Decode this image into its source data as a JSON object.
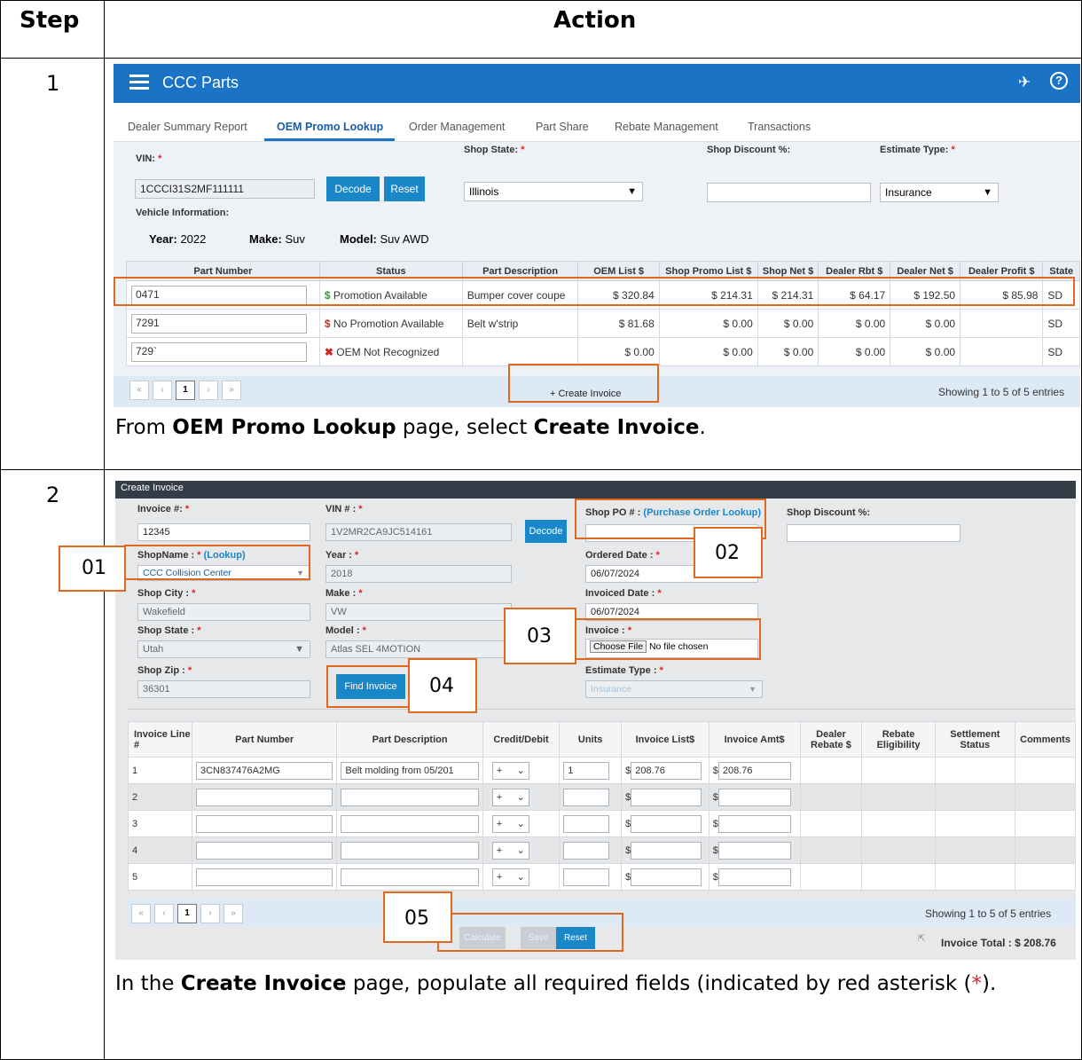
{
  "table_headers": {
    "step": "Step",
    "action": "Action"
  },
  "steps": [
    {
      "number": "1",
      "caption_pre": "From ",
      "caption_b1": "OEM Promo Lookup",
      "caption_mid": " page, select ",
      "caption_b2": "Create Invoice",
      "caption_post": "."
    },
    {
      "number": "2",
      "caption_pre": "In the ",
      "caption_b1": "Create Invoice",
      "caption_mid": " page, populate all required fields (indicated by red asterisk (",
      "caption_star": "*",
      "caption_post": ")."
    }
  ],
  "app": {
    "title": "CCC Parts",
    "tabs": [
      "Dealer Summary Report",
      "OEM Promo Lookup",
      "Order Management",
      "Part Share",
      "Rebate Management",
      "Transactions"
    ],
    "vin_label": "VIN:",
    "vin_value": "1CCCI31S2MF111111",
    "decode": "Decode",
    "reset": "Reset",
    "shop_state_label": "Shop State:",
    "shop_state_value": "Illinois",
    "shop_discount_label": "Shop Discount %:",
    "estimate_type_label": "Estimate Type:",
    "estimate_type_value": "Insurance",
    "vehicle_info_label": "Vehicle Information:",
    "year_label": "Year:",
    "year_value": "2022",
    "make_label": "Make:",
    "make_value": "Suv",
    "model_label": "Model:",
    "model_value": "Suv AWD",
    "columns": [
      "Part Number",
      "Status",
      "Part Description",
      "OEM List $",
      "Shop Promo List $",
      "Shop Net $",
      "Dealer Rbt $",
      "Dealer Net $",
      "Dealer Profit $",
      "State"
    ],
    "rows": [
      {
        "part": "0471",
        "status_icon": "$",
        "status": "Promotion Available",
        "desc": "Bumper cover coupe",
        "oem": "$ 320.84",
        "promo": "$ 214.31",
        "net": "$ 214.31",
        "rbt": "$ 64.17",
        "dnet": "$ 192.50",
        "profit": "$ 85.98",
        "state": "SD"
      },
      {
        "part": "7291",
        "status_icon": "$",
        "status": "No Promotion Available",
        "desc": "Belt w'strip",
        "oem": "$ 81.68",
        "promo": "$ 0.00",
        "net": "$ 0.00",
        "rbt": "$ 0.00",
        "dnet": "$ 0.00",
        "profit": "",
        "state": "SD"
      },
      {
        "part": "729`",
        "status_icon": "✖",
        "status": "OEM Not Recognized",
        "desc": "",
        "oem": "$ 0.00",
        "promo": "$ 0.00",
        "net": "$ 0.00",
        "rbt": "$ 0.00",
        "dnet": "$ 0.00",
        "profit": "",
        "state": "SD"
      }
    ],
    "pager": [
      "«",
      "‹",
      "1",
      "›",
      "»"
    ],
    "create_invoice": "+ Create Invoice",
    "showing": "Showing 1 to 5 of 5 entries"
  },
  "invoice": {
    "title": "Create Invoice",
    "invoice_no_label": "Invoice #:",
    "invoice_no": "12345",
    "vin_label": "VIN # :",
    "vin": "1V2MR2CA9JC514161",
    "decode": "Decode",
    "shop_po_label": "Shop PO # :",
    "shop_po_link": "(Purchase Order Lookup)",
    "shop_discount_label": "Shop Discount %:",
    "shopname_label": "ShopName :",
    "lookup": "(Lookup)",
    "shopname": "CCC Collision Center",
    "year_label": "Year :",
    "year": "2018",
    "ordered_label": "Ordered Date :",
    "ordered": "06/07/2024",
    "city_label": "Shop City :",
    "city": "Wakefield",
    "make_label": "Make :",
    "make": "VW",
    "invoiced_label": "Invoiced Date :",
    "invoiced": "06/07/2024",
    "state_label": "Shop State :",
    "state": "Utah",
    "model_label": "Model :",
    "model": "Atlas SEL 4MOTION",
    "inv_file_label": "Invoice :",
    "choose_file": "Choose File",
    "no_file": "No file chosen",
    "zip_label": "Shop Zip :",
    "zip": "36301",
    "find_invoice": "Find Invoice",
    "estimate_label": "Estimate Type :",
    "estimate": "Insurance",
    "columns": [
      "Invoice Line #",
      "Part Number",
      "Part Description",
      "Credit/Debit",
      "Units",
      "Invoice List$",
      "Invoice Amt$",
      "Dealer Rebate $",
      "Rebate Eligibility",
      "Settlement Status",
      "Comments"
    ],
    "lines": [
      {
        "n": "1",
        "part": "3CN837476A2MG",
        "desc": "Belt molding from 05/201",
        "cd": "+",
        "units": "1",
        "list": "208.76",
        "amt": "208.76"
      },
      {
        "n": "2",
        "part": "",
        "desc": "",
        "cd": "+",
        "units": "",
        "list": "",
        "amt": ""
      },
      {
        "n": "3",
        "part": "",
        "desc": "",
        "cd": "+",
        "units": "",
        "list": "",
        "amt": ""
      },
      {
        "n": "4",
        "part": "",
        "desc": "",
        "cd": "+",
        "units": "",
        "list": "",
        "amt": ""
      },
      {
        "n": "5",
        "part": "",
        "desc": "",
        "cd": "+",
        "units": "",
        "list": "",
        "amt": ""
      }
    ],
    "showing": "Showing 1 to 5 of 5 entries",
    "calculate": "Calculate",
    "save": "Save",
    "reset": "Reset",
    "total": "Invoice Total : $ 208.76",
    "currency": "$"
  },
  "callouts": [
    "01",
    "02",
    "03",
    "04",
    "05"
  ],
  "colors": {
    "accent": "#1a87c9",
    "callout": "#e0681f",
    "required": "#e02020"
  }
}
